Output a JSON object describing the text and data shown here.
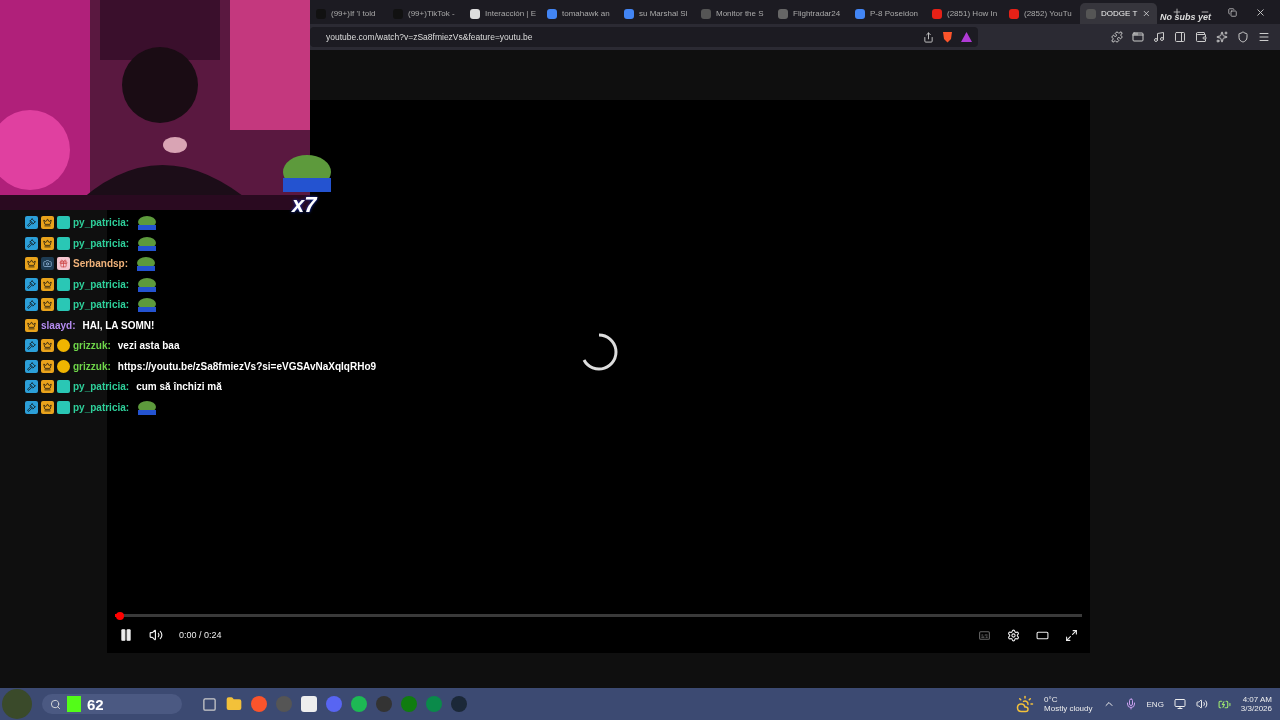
{
  "browser": {
    "tabs": [
      {
        "label": "(99+)If 'I told",
        "kind": "tiktok",
        "selected": false
      },
      {
        "label": "(99+)TikTok -",
        "kind": "tiktok",
        "selected": false
      },
      {
        "label": "Interacción | E",
        "kind": "diamond",
        "selected": false
      },
      {
        "label": "tomahawk an",
        "kind": "google",
        "selected": false
      },
      {
        "label": "su Marshal Sl",
        "kind": "google",
        "selected": false
      },
      {
        "label": "Monitor the S",
        "kind": "generic",
        "selected": false
      },
      {
        "label": "Flightradar24",
        "kind": "radar",
        "selected": false
      },
      {
        "label": "P-8 Poseidon",
        "kind": "google",
        "selected": false
      },
      {
        "label": "(2851) How In",
        "kind": "youtube",
        "selected": false
      },
      {
        "label": "(2852) YouTu",
        "kind": "youtube",
        "selected": false
      },
      {
        "label": "DODGE T",
        "kind": "generic",
        "selected": true
      }
    ],
    "url": "youtube.com/watch?v=zSa8fmiezVs&feature=youtu.be"
  },
  "overlay": {
    "subs": "No subs yet",
    "combo": "x7"
  },
  "chat": [
    {
      "badges": [
        {
          "kind": "mod"
        },
        {
          "kind": "vip"
        },
        {
          "kind": "bg"
        }
      ],
      "user": "py_patricia:",
      "color": "#2ecf9a",
      "kind": "emote"
    },
    {
      "badges": [
        {
          "kind": "mod"
        },
        {
          "kind": "vip"
        },
        {
          "kind": "bg"
        }
      ],
      "user": "py_patricia:",
      "color": "#2ecf9a",
      "kind": "emote"
    },
    {
      "badges": [
        {
          "kind": "vip"
        },
        {
          "kind": "cam"
        },
        {
          "kind": "gift"
        }
      ],
      "user": "Serbandsp:",
      "color": "#f0b27a",
      "kind": "emote"
    },
    {
      "badges": [
        {
          "kind": "mod"
        },
        {
          "kind": "vip"
        },
        {
          "kind": "bg"
        }
      ],
      "user": "py_patricia:",
      "color": "#2ecf9a",
      "kind": "emote"
    },
    {
      "badges": [
        {
          "kind": "mod"
        },
        {
          "kind": "vip"
        },
        {
          "kind": "bg"
        }
      ],
      "user": "py_patricia:",
      "color": "#2ecf9a",
      "kind": "emote"
    },
    {
      "badges": [
        {
          "kind": "vip"
        }
      ],
      "user": "slaayd:",
      "color": "#b58cf0",
      "kind": "text",
      "text": "HAI, LA SOMN!"
    },
    {
      "badges": [
        {
          "kind": "mod"
        },
        {
          "kind": "vip"
        },
        {
          "kind": "coin"
        }
      ],
      "user": "grizzuk:",
      "color": "#6fd64a",
      "kind": "text",
      "text": "vezi asta baa"
    },
    {
      "badges": [
        {
          "kind": "mod"
        },
        {
          "kind": "vip"
        },
        {
          "kind": "coin"
        }
      ],
      "user": "grizzuk:",
      "color": "#6fd64a",
      "kind": "text",
      "text": "https://youtu.be/zSa8fmiezVs?si=eVGSAvNaXqlqRHo9"
    },
    {
      "badges": [
        {
          "kind": "mod"
        },
        {
          "kind": "vip"
        },
        {
          "kind": "bg"
        }
      ],
      "user": "py_patricia:",
      "color": "#2ecf9a",
      "kind": "text",
      "text": "cum să închizi mă"
    },
    {
      "badges": [
        {
          "kind": "mod"
        },
        {
          "kind": "vip"
        },
        {
          "kind": "bg"
        }
      ],
      "user": "py_patricia:",
      "color": "#2ecf9a",
      "kind": "emote"
    }
  ],
  "player": {
    "level": 0.005,
    "time": "0:00 / 0:24"
  },
  "taskbar": {
    "score": "62",
    "temperature": "0°C",
    "weather": "Mostly cloudy",
    "language": "ENG",
    "time": "4:07 AM",
    "date": "3/3/2026"
  }
}
